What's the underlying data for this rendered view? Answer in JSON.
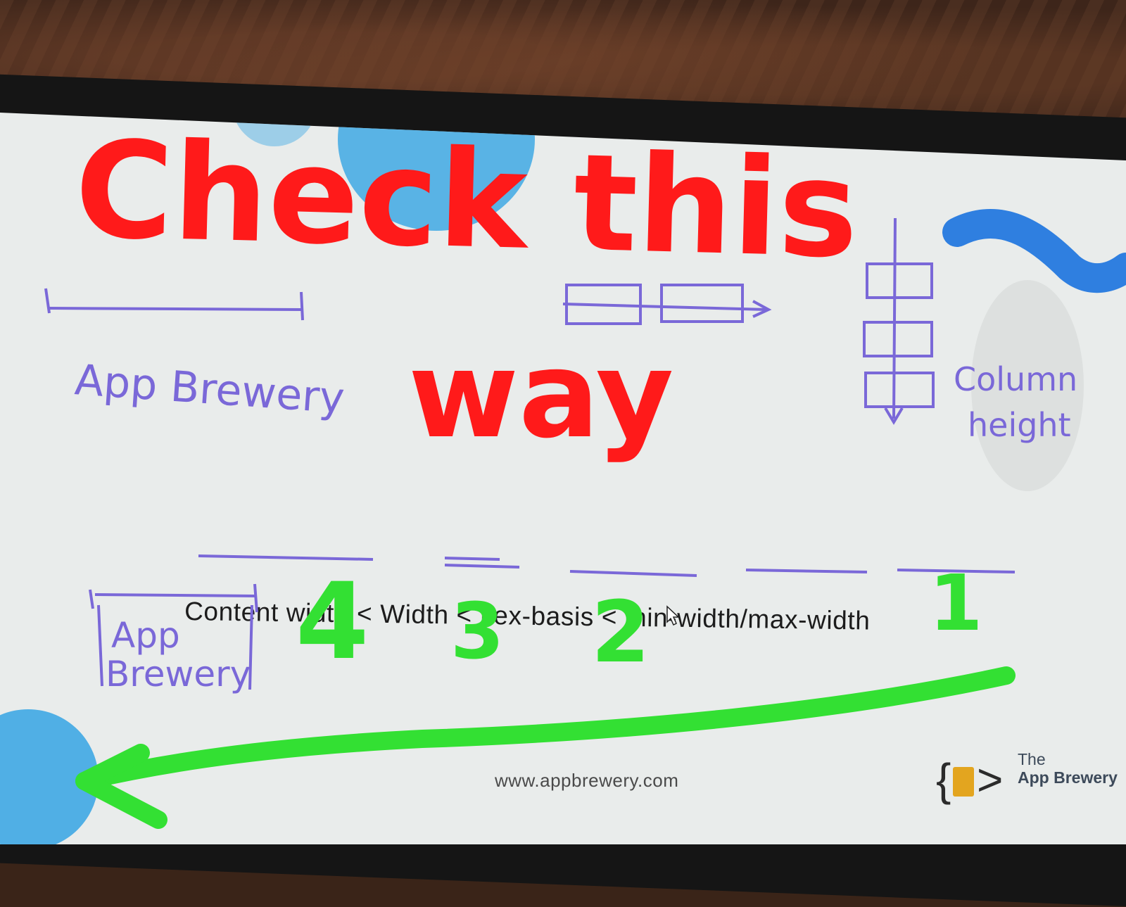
{
  "slide": {
    "formula": "Content width < Width < flex-basis < min-width/max-width",
    "url": "www.appbrewery.com",
    "brand_line1": "The",
    "brand_line2": "App Brewery",
    "brand_color": "#e3a51f"
  },
  "annotations": {
    "red_heading_line1": "Check this",
    "red_heading_line2": "way",
    "purple_label_top": "App Brewery",
    "purple_label_box_line1": "App",
    "purple_label_box_line2": "Brewery",
    "column_label_line1": "Column",
    "column_label_line2": "height",
    "rank_4": "4",
    "rank_3": "3",
    "rank_2": "2",
    "rank_1": "1",
    "red_color": "#ff1a1a",
    "green_color": "#33e033",
    "purple_color": "#7a68d8"
  }
}
